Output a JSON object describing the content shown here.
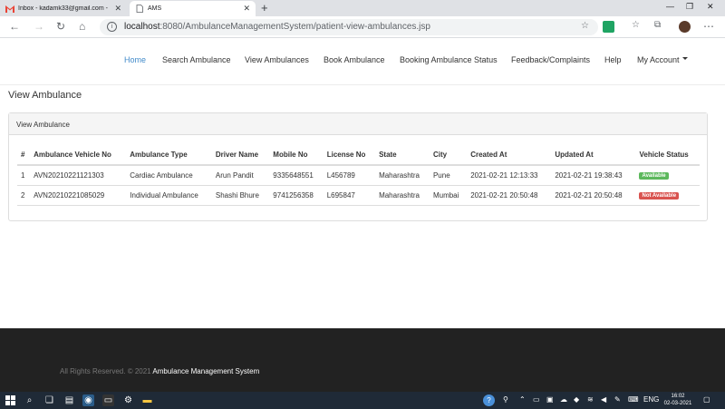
{
  "browser": {
    "tabs": [
      {
        "title": "Inbox - kadamk33@gmail.com -",
        "icon": "gmail-icon"
      },
      {
        "title": "AMS",
        "icon": "page-icon"
      }
    ],
    "url_host": "localhost",
    "url_path": ":8080/AmbulanceManagementSystem/patient-view-ambulances.jsp"
  },
  "nav": {
    "items": [
      "Home",
      "Search Ambulance",
      "View Ambulances",
      "Book Ambulance",
      "Booking Ambulance Status",
      "Feedback/Complaints",
      "Help",
      "My Account"
    ],
    "active": "Home"
  },
  "page": {
    "title": "View Ambulance",
    "panel_heading": "View Ambulance"
  },
  "table": {
    "headers": [
      "#",
      "Ambulance Vehicle No",
      "Ambulance Type",
      "Driver Name",
      "Mobile No",
      "License No",
      "State",
      "City",
      "Created At",
      "Updated At",
      "Vehicle Status"
    ],
    "rows": [
      {
        "n": "1",
        "vehicle": "AVN20210221121303",
        "type": "Cardiac Ambulance",
        "driver": "Arun Pandit",
        "mobile": "9335648551",
        "license": "L456789",
        "state": "Maharashtra",
        "city": "Pune",
        "created": "2021-02-21 12:13:33",
        "updated": "2021-02-21 19:38:43",
        "status": "Available",
        "status_color": "#5cb85c"
      },
      {
        "n": "2",
        "vehicle": "AVN20210221085029",
        "type": "Individual Ambulance",
        "driver": "Shashi Bhure",
        "mobile": "9741256358",
        "license": "L695847",
        "state": "Maharashtra",
        "city": "Mumbai",
        "created": "2021-02-21 20:50:48",
        "updated": "2021-02-21 20:50:48",
        "status": "Not Available",
        "status_color": "#d9534f"
      }
    ]
  },
  "footer": {
    "prefix": "All Rights Reserved. © 2021",
    "brand": "Ambulance Management System"
  },
  "taskbar": {
    "lang": "ENG",
    "time": "16:02",
    "date": "02-03-2021"
  }
}
